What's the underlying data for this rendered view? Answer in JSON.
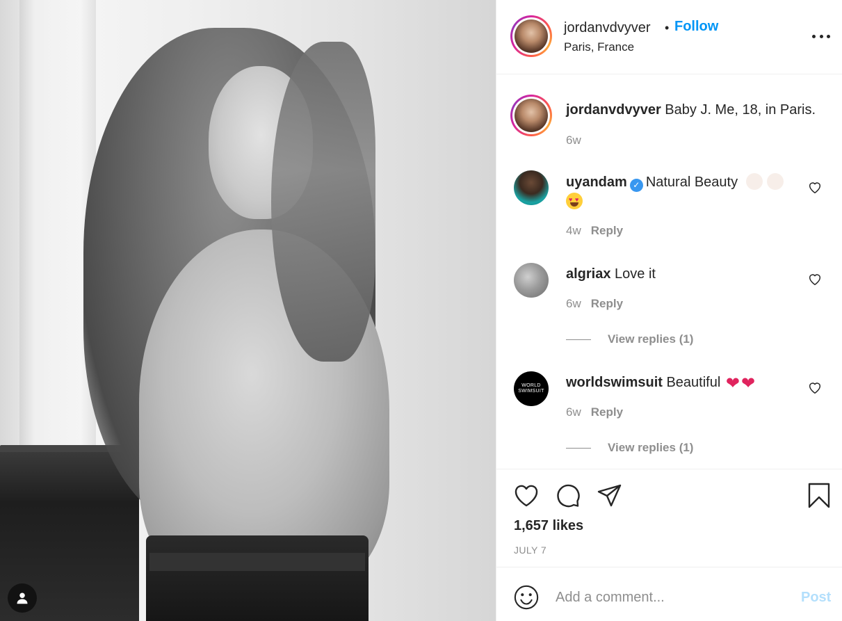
{
  "post": {
    "username": "jordanvdvyver",
    "follow_label": "Follow",
    "separator": "•",
    "location": "Paris, France"
  },
  "caption": {
    "username": "jordanvdvyver",
    "text": "Baby J. Me, 18, in Paris.",
    "time": "6w"
  },
  "comments": [
    {
      "username": "uyandam",
      "verified": true,
      "text": "Natural Beauty",
      "time": "4w",
      "reply_label": "Reply"
    },
    {
      "username": "algriax",
      "verified": false,
      "text": "Love it",
      "time": "6w",
      "reply_label": "Reply",
      "view_replies": "View replies (1)"
    },
    {
      "username": "worldswimsuit",
      "verified": false,
      "text": "Beautiful",
      "time": "6w",
      "reply_label": "Reply",
      "view_replies": "View replies (1)"
    }
  ],
  "worldswimsuit_avatar": {
    "line1": "WORLD",
    "line2": "SWIMSUIT"
  },
  "likes": "1,657 likes",
  "date": "JULY 7",
  "add_comment": {
    "placeholder": "Add a comment...",
    "post_label": "Post"
  },
  "icons": {
    "more": "more-options-icon",
    "like": "heart-icon",
    "comment": "comment-icon",
    "share": "share-icon",
    "save": "bookmark-icon",
    "emoji": "emoji-icon",
    "user_tag": "user-tag-icon",
    "verified": "verified-badge-icon"
  },
  "colors": {
    "accent": "#0095f6",
    "post_disabled": "#b3dffc",
    "muted_text": "#8e8e8e",
    "text": "#262626",
    "border": "#efefef"
  }
}
